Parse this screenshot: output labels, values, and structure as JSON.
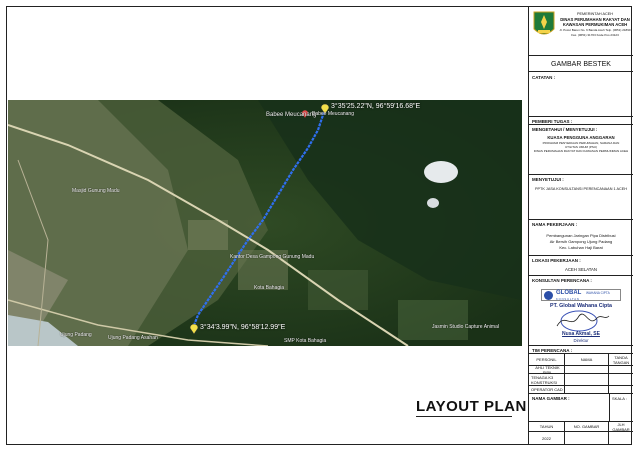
{
  "header": {
    "line1": "PEMERINTAH ACEH",
    "line2": "DINAS PERUMAHAN RAKYAT DAN",
    "line3": "KAWASAN PERMUKIMAN ACEH",
    "address": "Jl. Pocut Baren No. 6 Banda Aceh Telp. (0651) 21890",
    "fax": "Fax. (0651) 31703 Kode Pos 23123",
    "logo": "aceh-shield-logo"
  },
  "title_block": {
    "sheet_title": "GAMBAR BESTEK",
    "catatan": "CATATAN :",
    "pemberi_tugas": "PEMBERI TUGAS :",
    "mengetahui": "MENGETAHUI / MENYETUJUI :",
    "kuasa": "KUASA PENGGUNA ANGGARAN",
    "kuasa_sub1": "PROGRAM PENYEDIAAN PERUMAHAN, SARANA DAN",
    "kuasa_sub2": "UTILITAS UMUM (PSU)",
    "kuasa_sub3": "DINAS PERUMAHAN RAKYAT DAN KAWASAN PERMUKIMAN ACEH",
    "menyetujui": "MENYETUJUI :",
    "pptk": "PPTK JASA KONSULTANSI PERENCANAAN 1 ACEH",
    "nama_pekerjaan": "NAMA PEKERJAAN :",
    "pekerjaan1": "Pembangunan Jaringan Pipa Distribusi",
    "pekerjaan2": "Air Bersih Gampong Ujung Padang",
    "pekerjaan3": "Kec. Labuhan Haji Barat",
    "lokasi": "LOKASI PEKERJAAN :",
    "lokasi_value": "ACEH SELATAN",
    "konsultan": "KONSULTAN PERENCANA :",
    "konsultan_logo_text": "GLOBAL",
    "konsultan_logo_sub": "WAHANA CIPTA",
    "konsultan_logo_sub2": "K O N S U L T A N",
    "company": "PT. Global Wahana Cipta",
    "signer": "Nusa Akmal, SE",
    "signer_title": "Direktur",
    "tim": "TIM PERENCANA :",
    "col_personil": "PERSONIL",
    "col_nama": "NAMA",
    "col_tanda": "TANDA TANGAN",
    "role1": "AHLI TEKNIK SIPIL",
    "role2": "TENAGA K3 KONSTRUKSI",
    "role3": "OPERATOR CAD",
    "nama_gambar": "NAMA GAMBAR :",
    "skala": "SKALA :",
    "col_tahun": "TAHUN",
    "col_no": "NO. GAMBAR",
    "col_jlh": "JLH GAMBAR",
    "tahun_value": "2022"
  },
  "map": {
    "coord_top": "3°35'25.22\"N, 96°59'16.68\"E",
    "coord_bottom": "3°34'3.99\"N, 96°58'12.99\"E",
    "place1": "Babee Meucanang",
    "place2": "Babee Meucanang",
    "place3": "Kantor Desa Gampong Gunung Madu",
    "place4": "Kota Bahagia",
    "place5": "Masjid Gunung Madu",
    "place6": "Ujung Padang",
    "place7": "Jasmin Studio Capture Animal",
    "place8": "Ujung Padang Asahan",
    "place9": "SMP Kota Bahagia"
  },
  "drawing_title": "LAYOUT PLAN"
}
